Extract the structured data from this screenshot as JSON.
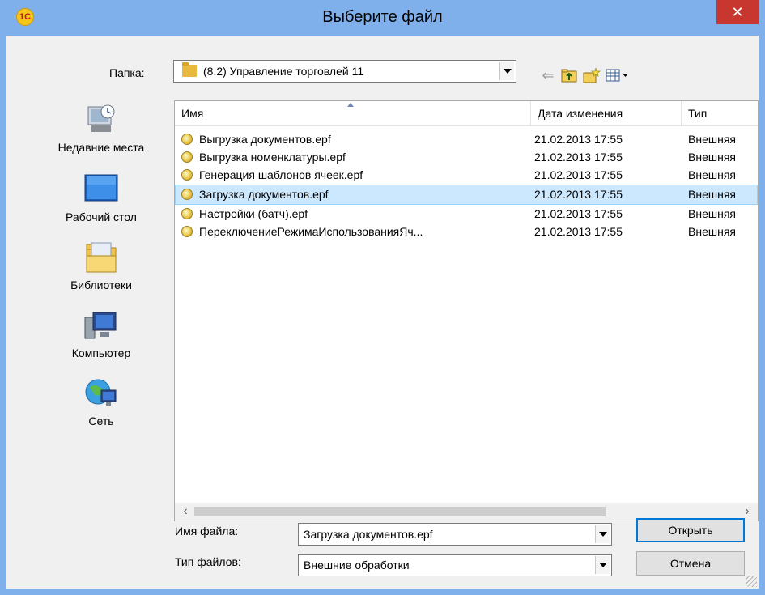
{
  "window": {
    "title": "Выберите файл",
    "app_icon_text": "1С",
    "close_glyph": "✕"
  },
  "folder": {
    "label": "Папка:",
    "value": "(8.2) Управление торговлей 11"
  },
  "toolbar": {
    "back_glyph": "⇐",
    "up_glyph": "⬆",
    "newfolder_glyph": "✦",
    "view_glyph": "▦"
  },
  "places": [
    {
      "label": "Недавние места",
      "icon": "recent-places-icon"
    },
    {
      "label": "Рабочий стол",
      "icon": "desktop-icon"
    },
    {
      "label": "Библиотеки",
      "icon": "libraries-icon"
    },
    {
      "label": "Компьютер",
      "icon": "computer-icon"
    },
    {
      "label": "Сеть",
      "icon": "network-icon"
    }
  ],
  "list": {
    "columns": [
      "Имя",
      "Дата изменения",
      "Тип"
    ],
    "rows": [
      {
        "name": "Выгрузка документов.epf",
        "date": "21.02.2013 17:55",
        "type": "Внешняя",
        "selected": false
      },
      {
        "name": "Выгрузка номенклатуры.epf",
        "date": "21.02.2013 17:55",
        "type": "Внешняя",
        "selected": false
      },
      {
        "name": "Генерация шаблонов ячеек.epf",
        "date": "21.02.2013 17:55",
        "type": "Внешняя",
        "selected": false
      },
      {
        "name": "Загрузка документов.epf",
        "date": "21.02.2013 17:55",
        "type": "Внешняя",
        "selected": true
      },
      {
        "name": "Настройки (батч).epf",
        "date": "21.02.2013 17:55",
        "type": "Внешняя",
        "selected": false
      },
      {
        "name": "ПереключениеРежимаИспользованияЯч...",
        "date": "21.02.2013 17:55",
        "type": "Внешняя",
        "selected": false
      }
    ],
    "scroll_left": "‹",
    "scroll_right": "›"
  },
  "filename": {
    "label": "Имя файла:",
    "value": "Загрузка документов.epf"
  },
  "filetype": {
    "label": "Тип файлов:",
    "value": "Внешние обработки"
  },
  "buttons": {
    "open": "Открыть",
    "cancel": "Отмена"
  },
  "colors": {
    "titlebar": "#7fb0ec",
    "close": "#c7372f",
    "selection": "#cce8ff"
  }
}
